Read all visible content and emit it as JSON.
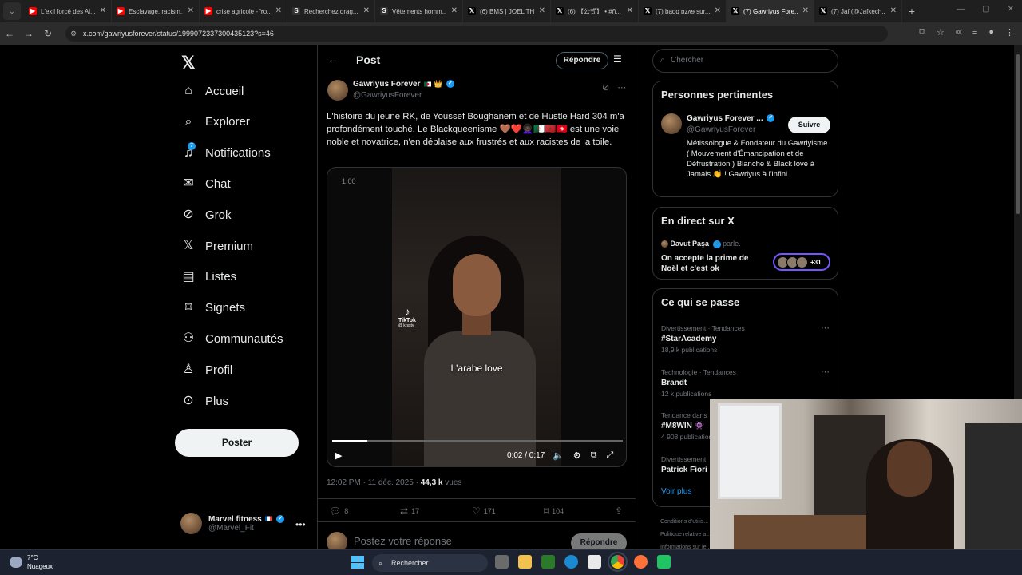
{
  "browser": {
    "tabs": [
      {
        "title": "L'exil forcé des Al...",
        "icon": "youtube-icon",
        "color": "#ff0000",
        "glyph": "▶"
      },
      {
        "title": "Esclavage, racism...",
        "icon": "youtube-icon",
        "color": "#ff0000",
        "glyph": "▶"
      },
      {
        "title": "crise agricole - Yo...",
        "icon": "youtube-icon",
        "color": "#ff0000",
        "glyph": "▶"
      },
      {
        "title": "Recherchez drag...",
        "icon": "s-icon",
        "color": "#333333",
        "glyph": "S"
      },
      {
        "title": "Vêtements homm...",
        "icon": "s-icon",
        "color": "#333333",
        "glyph": "S"
      },
      {
        "title": "(6) BMS | JOEL TH...",
        "icon": "x-icon",
        "color": "#000000",
        "glyph": "𝕏"
      },
      {
        "title": "(6) 【公式】 • #ñ...",
        "icon": "x-icon",
        "color": "#000000",
        "glyph": "𝕏"
      },
      {
        "title": "(7) bạdɋ ɒzʌɘ sur...",
        "icon": "x-icon",
        "color": "#000000",
        "glyph": "𝕏"
      },
      {
        "title": "(7) Gawriyus Fore...",
        "icon": "x-icon",
        "color": "#000000",
        "glyph": "𝕏",
        "active": true
      },
      {
        "title": "(7) Jaf (@Jafkech...",
        "icon": "x-icon",
        "color": "#000000",
        "glyph": "𝕏"
      }
    ],
    "url": "x.com/gawriyusforever/status/1999072337300435123?s=46"
  },
  "sidebar": {
    "logo": "𝕏",
    "items": [
      {
        "label": "Accueil",
        "icon": "home-icon",
        "glyph": "⌂"
      },
      {
        "label": "Explorer",
        "icon": "search-icon",
        "glyph": "⌕"
      },
      {
        "label": "Notifications",
        "icon": "bell-icon",
        "glyph": "♫",
        "badge": "7"
      },
      {
        "label": "Chat",
        "icon": "mail-icon",
        "glyph": "✉"
      },
      {
        "label": "Grok",
        "icon": "grok-icon",
        "glyph": "⊘"
      },
      {
        "label": "Premium",
        "icon": "x-icon",
        "glyph": "𝕏"
      },
      {
        "label": "Listes",
        "icon": "list-icon",
        "glyph": "▤"
      },
      {
        "label": "Signets",
        "icon": "bookmark-icon",
        "glyph": "⌑"
      },
      {
        "label": "Communautés",
        "icon": "people-icon",
        "glyph": "⚇"
      },
      {
        "label": "Profil",
        "icon": "user-icon",
        "glyph": "♙"
      },
      {
        "label": "Plus",
        "icon": "more-circle-icon",
        "glyph": "⊙"
      }
    ],
    "post_button": "Poster",
    "account": {
      "name": "Marvel fitness",
      "handle": "@Marvel_Fit"
    }
  },
  "post": {
    "header_title": "Post",
    "reply_button": "Répondre",
    "author_name": "Gawriyus Forever",
    "author_handle": "@GawriyusForever",
    "text": "L'histoire du jeune RK, de Youssef Boughanem et de Hustle Hard 304 m'a profondément touché. Le Blackqueenisme 🤎❤️👩🏿‍🦱🇩🇿🇲🇦🇹🇳 est une voie noble et novatrice, n'en déplaise aux frustrés et aux racistes de la toile.",
    "video": {
      "speed": "1.00",
      "watermark": "TikTok",
      "watermark_user": "@ krssty_",
      "caption": "L'arabe love",
      "time": "0:02 / 0:17",
      "progress": 0.12
    },
    "time": "12:02 PM",
    "date": "11 déc. 2025",
    "views": "44,3 k",
    "views_label": "vues",
    "stats": {
      "replies": "8",
      "reposts": "17",
      "likes": "171",
      "bookmarks": "104"
    },
    "composer_placeholder": "Postez votre réponse",
    "composer_button": "Répondre"
  },
  "right": {
    "search_placeholder": "Chercher",
    "relevant": {
      "title": "Personnes pertinentes",
      "name": "Gawriyus Forever ...",
      "handle": "@GawriyusForever",
      "follow": "Suivre",
      "bio": "Métissologue & Fondateur du Gawriyisme ( Mouvement d'Émancipation et de Défrustration ) Blanche & Black love à Jamais 👏 ! Gawriyus à l'infini."
    },
    "live": {
      "title": "En direct sur X",
      "host": "Davut Paşa",
      "status": "parle.",
      "topic": "On accepte la prime de Noël et c'est ok",
      "listeners": "+31"
    },
    "trends": {
      "title": "Ce qui se passe",
      "items": [
        {
          "category": "Divertissement · Tendances",
          "name": "#StarAcademy",
          "count": "18,9 k publications"
        },
        {
          "category": "Technologie · Tendances",
          "name": "Brandt",
          "count": "12 k publications"
        },
        {
          "category": "Tendance dans",
          "name": "#M8WIN 👾",
          "count": "4 908 publications"
        },
        {
          "category": "Divertissement",
          "name": "Patrick Fiori",
          "count": ""
        }
      ],
      "more": "Voir plus"
    },
    "footer": [
      "Conditions d'utilis...",
      "Politique relative a...",
      "Informations sur le..."
    ]
  },
  "taskbar": {
    "temp": "7°C",
    "weather": "Nuageux",
    "search": "Rechercher"
  }
}
